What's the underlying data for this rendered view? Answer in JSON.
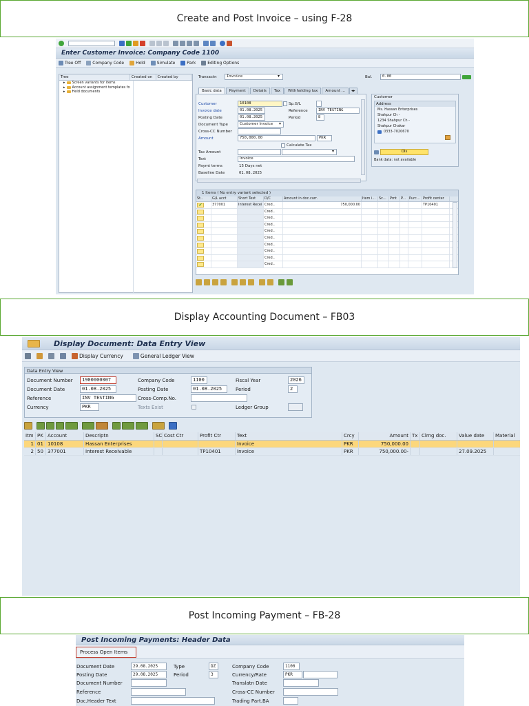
{
  "sections": {
    "f28_title": "Create and Post Invoice – using F-28",
    "fb03_title": "Display Accounting Document  –  FB03",
    "fb28_title": "Post Incoming Payment   –  FB-28"
  },
  "f28": {
    "screen_title": "Enter Customer Invoice: Company Code 1100",
    "toolbar": {
      "tree_off": "Tree Off",
      "company_code": "Company Code",
      "hold": "Hold",
      "simulate": "Simulate",
      "park": "Park",
      "editing_options": "Editing Options"
    },
    "tree": {
      "headers": [
        "Tree",
        "Created on",
        "Created by"
      ],
      "nodes": [
        "Screen variants for items",
        "Account assignment templates fo",
        "Held documents"
      ]
    },
    "transactn_label": "Transactn",
    "transactn_value": "Invoice",
    "bal_label": "Bal.",
    "bal_value": "0.00",
    "tabs": [
      "Basic data",
      "Payment",
      "Details",
      "Tax",
      "Withholding tax",
      "Amount ..."
    ],
    "form": {
      "customer_label": "Customer",
      "customer_value": "10108",
      "spgl_label": "Sp.G/L",
      "invoice_date_label": "Invoice date",
      "invoice_date_value": "01.08.2025",
      "reference_label": "Reference",
      "reference_value": "INV TESTING",
      "posting_date_label": "Posting Date",
      "posting_date_value": "01.08.2025",
      "period_label": "Period",
      "period_value": "8",
      "doc_type_label": "Document Type",
      "doc_type_value": "Customer Invoice",
      "cross_cc_label": "Cross-CC Number",
      "amount_label": "Amount",
      "amount_value": "750,000.00",
      "currency_value": "PKR",
      "calc_tax_label": "Calculate Tax",
      "tax_amount_label": "Tax Amount",
      "text_label": "Text",
      "text_value": "Invoice",
      "paymt_terms_label": "Paymt terms",
      "paymt_terms_value": "15 Days net",
      "baseline_label": "Baseline Date",
      "baseline_value": "01.08.2025"
    },
    "customer_box": {
      "title": "Customer",
      "address_title": "Address",
      "lines": [
        "Ms. Hassan Enterprises",
        "Shahpur Ch -",
        "1234 Shahpur Ch -",
        "Shahpur Chakar"
      ],
      "phone": "0333-7020670",
      "ois_label": "OIs",
      "bank_data": "Bank data: not available"
    },
    "items": {
      "title": "1 Items ( No entry variant selected )",
      "headers": [
        "St..",
        "G/L acct",
        "Short Text",
        "D/C",
        "Amount in doc.curr.",
        "Item i...",
        "Sc...",
        "Pmt",
        "P...",
        "Purc...",
        "Profit center"
      ],
      "row1": {
        "gl": "377001",
        "short_text": "Interest Recei",
        "dc": "Cred..",
        "amount": "750,000.00",
        "profit_center": "TP10401"
      },
      "empty_dc": "Cred.."
    }
  },
  "fb03": {
    "screen_title": "Display Document: Data Entry View",
    "toolbar": {
      "display_currency": "Display Currency",
      "general_ledger_view": "General Ledger View"
    },
    "box_title": "Data Entry View",
    "fields": {
      "doc_number_label": "Document Number",
      "doc_number_value": "1900000007",
      "company_code_label": "Company Code",
      "company_code_value": "1100",
      "fiscal_year_label": "Fiscal Year",
      "fiscal_year_value": "2026",
      "doc_date_label": "Document Date",
      "doc_date_value": "01.08.2025",
      "posting_date_label": "Posting Date",
      "posting_date_value": "01.08.2025",
      "period_label": "Period",
      "period_value": "2",
      "reference_label": "Reference",
      "reference_value": "INV TESTING",
      "cross_comp_label": "Cross-Comp.No.",
      "currency_label": "Currency",
      "currency_value": "PKR",
      "texts_exist_label": "Texts Exist",
      "ledger_group_label": "Ledger Group"
    },
    "table": {
      "headers": [
        "Itm",
        "PK",
        "Account",
        "Descriptn",
        "SC",
        "Cost Ctr",
        "Profit Ctr",
        "Text",
        "Crcy",
        "Amount",
        "Tx",
        "Clrng doc.",
        "Value date",
        "Material"
      ],
      "rows": [
        {
          "itm": "1",
          "pk": "01",
          "account": "10108",
          "desc": "Hassan Enterprises",
          "profit": "",
          "text": "Invoice",
          "crcy": "PKR",
          "amount": "750,000.00",
          "value_date": ""
        },
        {
          "itm": "2",
          "pk": "50",
          "account": "377001",
          "desc": "Interest Receivable",
          "profit": "TP10401",
          "text": "Invoice",
          "crcy": "PKR",
          "amount": "750,000.00-",
          "value_date": "27.09.2025"
        }
      ]
    }
  },
  "fb28": {
    "screen_title": "Post Incoming Payments: Header Data",
    "process_button": "Process Open Items",
    "fields": {
      "doc_date_label": "Document Date",
      "doc_date_value": "29.08.2025",
      "type_label": "Type",
      "type_value": "DZ",
      "company_code_label": "Company Code",
      "company_code_value": "1100",
      "posting_date_label": "Posting Date",
      "posting_date_value": "29.08.2025",
      "period_label": "Period",
      "period_value": "3",
      "currency_rate_label": "Currency/Rate",
      "currency_value": "PKR",
      "doc_number_label": "Document Number",
      "translatn_label": "Translatn Date",
      "reference_label": "Reference",
      "cross_cc_label": "Cross-CC Number",
      "header_text_label": "Doc.Header Text",
      "trading_part_label": "Trading Part.BA"
    }
  },
  "colors": {
    "banner_border": "#5aa832",
    "sap_bg": "#dfe8f1",
    "selected_row": "#fcd77c",
    "required_field": "#fff6c4",
    "highlight_button_border": "#c0392b"
  }
}
